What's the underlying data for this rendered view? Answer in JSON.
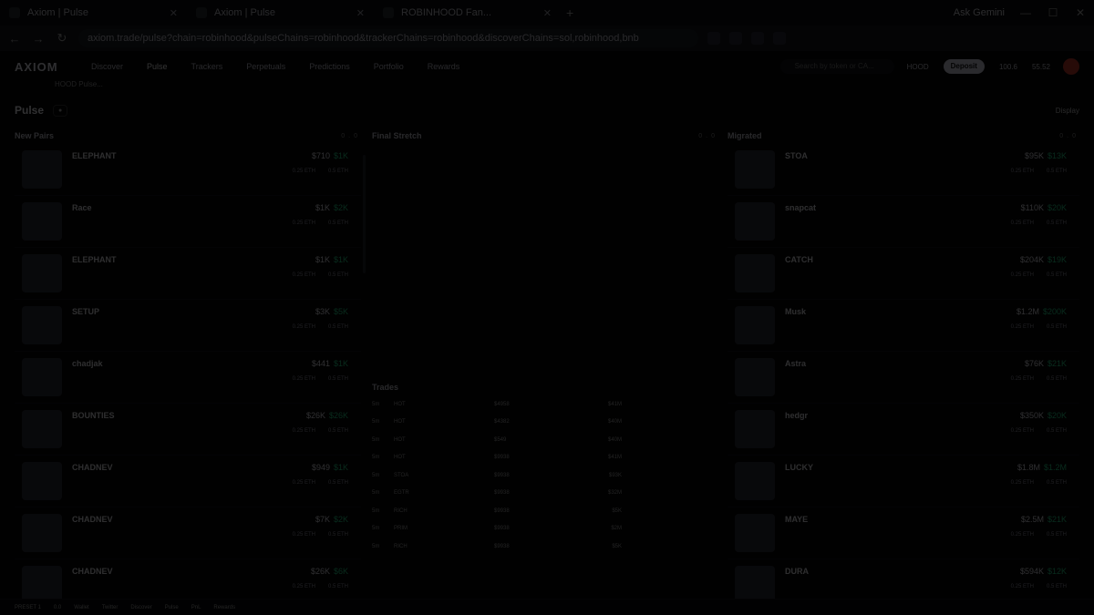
{
  "browser": {
    "tabs": [
      {
        "label": "Axiom | Pulse"
      },
      {
        "label": "Axiom | Pulse"
      },
      {
        "label": "ROBINHOOD Fan..."
      }
    ],
    "ask_gemini": "Ask Gemini",
    "url": "axiom.trade/pulse?chain=robinhood&pulseChains=robinhood&trackerChains=robinhood&discoverChains=sol,robinhood,bnb"
  },
  "topnav": {
    "logo": "AXIOM",
    "items": [
      "Discover",
      "Pulse",
      "Trackers",
      "Perpetuals",
      "Predictions",
      "Portfolio",
      "Rewards"
    ],
    "search_placeholder": "Search by token or CA...",
    "network": "HOOD",
    "deposit": "Deposit",
    "wallet_a": "100.6",
    "wallet_b": "55.52"
  },
  "subbar": "HOOD Pulse...",
  "pulse": {
    "title": "Pulse",
    "display": "Display",
    "new_pairs": "New Pairs",
    "final_stretch": "Final Stretch",
    "migrated": "Migrated",
    "col_value": "0.0"
  },
  "new_pairs": [
    {
      "name": "ELEPHANT",
      "mc": "$710",
      "v": "$1K",
      "eth_a": "0.25 ETH",
      "eth_b": "0.5 ETH"
    },
    {
      "name": "Race",
      "mc": "$1K",
      "v": "$2K",
      "eth_a": "0.25 ETH",
      "eth_b": "0.5 ETH"
    },
    {
      "name": "ELEPHANT",
      "mc": "$1K",
      "v": "$1K",
      "eth_a": "0.25 ETH",
      "eth_b": "0.5 ETH"
    },
    {
      "name": "SETUP",
      "mc": "$3K",
      "v": "$5K",
      "eth_a": "0.25 ETH",
      "eth_b": "0.5 ETH"
    },
    {
      "name": "chadjak",
      "mc": "$441",
      "v": "$1K",
      "eth_a": "0.25 ETH",
      "eth_b": "0.5 ETH"
    },
    {
      "name": "BOUNTIES",
      "mc": "$26K",
      "v": "$26K",
      "eth_a": "0.25 ETH",
      "eth_b": "0.5 ETH"
    },
    {
      "name": "CHADNEV",
      "mc": "$949",
      "v": "$1K",
      "eth_a": "0.25 ETH",
      "eth_b": "0.5 ETH"
    },
    {
      "name": "CHADNEV",
      "mc": "$7K",
      "v": "$2K",
      "eth_a": "0.25 ETH",
      "eth_b": "0.5 ETH"
    },
    {
      "name": "CHADNEV",
      "mc": "$26K",
      "v": "$6K",
      "eth_a": "0.25 ETH",
      "eth_b": "0.5 ETH"
    }
  ],
  "migrated": [
    {
      "name": "STOA",
      "mc": "$95K",
      "v": "$13K",
      "eth_a": "0.25 ETH",
      "eth_b": "0.5 ETH"
    },
    {
      "name": "snapcat",
      "mc": "$110K",
      "v": "$20K",
      "eth_a": "0.25 ETH",
      "eth_b": "0.5 ETH"
    },
    {
      "name": "CATCH",
      "mc": "$204K",
      "v": "$19K",
      "eth_a": "0.25 ETH",
      "eth_b": "0.5 ETH"
    },
    {
      "name": "Musk",
      "mc": "$1.2M",
      "v": "$200K",
      "eth_a": "0.25 ETH",
      "eth_b": "0.5 ETH"
    },
    {
      "name": "Astra",
      "mc": "$76K",
      "v": "$21K",
      "eth_a": "0.25 ETH",
      "eth_b": "0.5 ETH"
    },
    {
      "name": "hedgr",
      "mc": "$350K",
      "v": "$20K",
      "eth_a": "0.25 ETH",
      "eth_b": "0.5 ETH"
    },
    {
      "name": "LUCKY",
      "mc": "$1.8M",
      "v": "$1.2M",
      "eth_a": "0.25 ETH",
      "eth_b": "0.5 ETH"
    },
    {
      "name": "MAYE",
      "mc": "$2.5M",
      "v": "$21K",
      "eth_a": "0.25 ETH",
      "eth_b": "0.5 ETH"
    },
    {
      "name": "DURA",
      "mc": "$594K",
      "v": "$12K",
      "eth_a": "0.25 ETH",
      "eth_b": "0.5 ETH"
    }
  ],
  "trades": [
    {
      "t": "5m",
      "token": "HOT",
      "amt": "$4958",
      "v": "$41M"
    },
    {
      "t": "5m",
      "token": "HOT",
      "amt": "$4382",
      "v": "$40M"
    },
    {
      "t": "5m",
      "token": "HOT",
      "amt": "$549",
      "v": "$40M"
    },
    {
      "t": "5m",
      "token": "HOT",
      "amt": "$9938",
      "v": "$41M"
    },
    {
      "t": "5m",
      "token": "STOA",
      "amt": "$9938",
      "v": "$93K"
    },
    {
      "t": "5m",
      "token": "EGTR",
      "amt": "$9938",
      "v": "$32M"
    },
    {
      "t": "5m",
      "token": "RICH",
      "amt": "$9938",
      "v": "$5K"
    },
    {
      "t": "5m",
      "token": "PRIM",
      "amt": "$9938",
      "v": "$2M"
    },
    {
      "t": "5m",
      "token": "RICH",
      "amt": "$9938",
      "v": "$5K"
    }
  ],
  "trades_label": "Trades",
  "footer": [
    "PRESET 1",
    "0.0",
    "Wallet",
    "Twitter",
    "Discover",
    "Pulse",
    "PnL",
    "Rewards"
  ]
}
